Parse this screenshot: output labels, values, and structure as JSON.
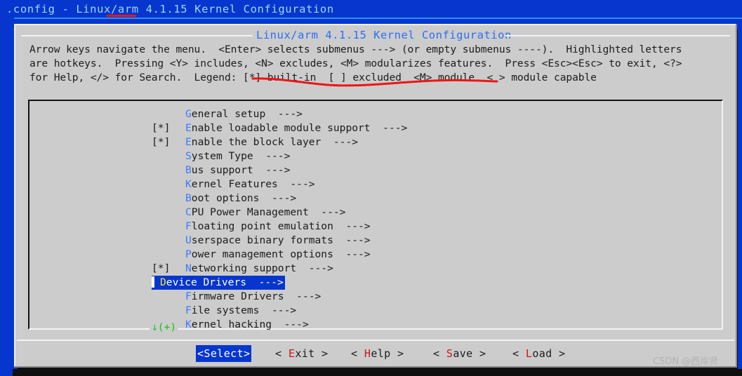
{
  "window": {
    "title": ".config - Linux/arm 4.1.15 Kernel Configuration",
    "titlebar_bg": "#0636cd",
    "title_color": "#9fd6f0",
    "annotation_underline_color": "#f01414"
  },
  "dialog": {
    "title": "Linux/arm 4.1.15 Kernel Configuration",
    "title_color": "#2b6ef5",
    "background": "#cccccc",
    "help_lines": [
      "Arrow keys navigate the menu.  <Enter> selects submenus ---> (or empty submenus ----).  Highlighted letters",
      "are hotkeys.  Pressing <Y> includes, <N> excludes, <M> modularizes features.  Press <Esc><Esc> to exit, <?>",
      "for Help, </> for Search.  Legend: [*] built-in  [ ] excluded  <M> module  < > module capable"
    ],
    "annotation_squiggle_color": "#f01414"
  },
  "menu": {
    "hotkey_color": "#3d7bf7",
    "selection_bg": "#0636cd",
    "selection_hotkey_color": "#f7e03a",
    "scroll_indicator": "↓(+)",
    "scroll_indicator_color": "#14c414",
    "items": [
      {
        "flag": "    ",
        "hotkey": "G",
        "label": "eneral setup  --->",
        "selected": false
      },
      {
        "flag": "[*] ",
        "hotkey": "E",
        "label": "nable loadable module support  --->",
        "selected": false
      },
      {
        "flag": "[*] ",
        "hotkey": "E",
        "label": "nable the block layer  --->",
        "selected": false
      },
      {
        "flag": "    ",
        "hotkey": "S",
        "label": "ystem Type  --->",
        "selected": false
      },
      {
        "flag": "    ",
        "hotkey": "B",
        "label": "us support  --->",
        "selected": false
      },
      {
        "flag": "    ",
        "hotkey": "K",
        "label": "ernel Features  --->",
        "selected": false
      },
      {
        "flag": "    ",
        "hotkey": "B",
        "label": "oot options  --->",
        "selected": false
      },
      {
        "flag": "    ",
        "hotkey": "C",
        "label": "PU Power Management  --->",
        "selected": false
      },
      {
        "flag": "    ",
        "hotkey": "F",
        "label": "loating point emulation  --->",
        "selected": false
      },
      {
        "flag": "    ",
        "hotkey": "U",
        "label": "serspace binary formats  --->",
        "selected": false
      },
      {
        "flag": "    ",
        "hotkey": "P",
        "label": "ower management options  --->",
        "selected": false
      },
      {
        "flag": "[*] ",
        "hotkey": "N",
        "label": "etworking support  --->",
        "selected": false
      },
      {
        "flag": "    ",
        "hotkey": "D",
        "label": "evice Drivers  --->",
        "selected": true
      },
      {
        "flag": "    ",
        "hotkey": "F",
        "label": "irmware Drivers  --->",
        "selected": false
      },
      {
        "flag": "    ",
        "hotkey": "F",
        "label": "ile systems  --->",
        "selected": false
      },
      {
        "flag": "    ",
        "hotkey": "K",
        "label": "ernel hacking  --->",
        "selected": false
      }
    ]
  },
  "buttons": {
    "active_bg": "#0636cd",
    "hotkey_color": "#d01414",
    "items": [
      {
        "pre": "",
        "hotkey": "",
        "post": "<Select>",
        "active": true,
        "name": "select"
      },
      {
        "pre": "< ",
        "hotkey": "E",
        "post": "xit >",
        "active": false,
        "name": "exit"
      },
      {
        "pre": "< ",
        "hotkey": "H",
        "post": "elp >",
        "active": false,
        "name": "help"
      },
      {
        "pre": "< ",
        "hotkey": "S",
        "post": "ave >",
        "active": false,
        "name": "save"
      },
      {
        "pre": "< ",
        "hotkey": "L",
        "post": "oad >",
        "active": false,
        "name": "load"
      }
    ]
  },
  "watermark": {
    "text": "CSDN @西岸贤"
  }
}
